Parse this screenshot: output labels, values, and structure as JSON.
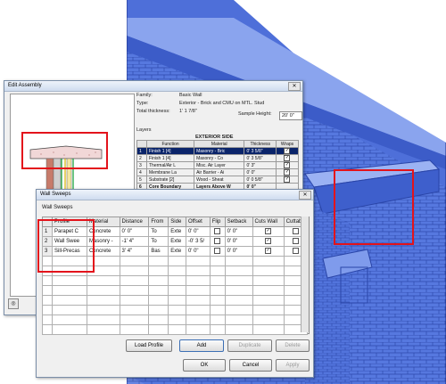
{
  "edit_assembly": {
    "title": "Edit Assembly",
    "family_label": "Family:",
    "family_value": "Basic Wall",
    "type_label": "Type:",
    "type_value": "Exterior - Brick and CMU on MTL. Stud",
    "thickness_label": "Total thickness:",
    "thickness_value": "1' 1 7/8\"",
    "sample_label": "Sample Height:",
    "sample_value": "20' 0\"",
    "layers_label": "Layers",
    "exterior_side": "EXTERIOR SIDE",
    "columns": [
      "Function",
      "Material",
      "Thickness",
      "Wraps"
    ],
    "rows": [
      {
        "n": "1",
        "function": "Finish 1 [4]",
        "material": "Masonry - Bric",
        "thickness": "0' 3 5/8\"",
        "wraps": true,
        "selected": true
      },
      {
        "n": "2",
        "function": "Finish 1 [4]",
        "material": "Masonry - Co",
        "thickness": "0' 3 5/8\"",
        "wraps": true
      },
      {
        "n": "3",
        "function": "Thermal/Air L",
        "material": "Misc. Air Layer",
        "thickness": "0' 3\"",
        "wraps": true
      },
      {
        "n": "4",
        "function": "Membrane La",
        "material": "Air Barrier - Ai",
        "thickness": "0' 0\"",
        "wraps": true
      },
      {
        "n": "5",
        "function": "Substrate [2]",
        "material": "Wood - Sheat",
        "thickness": "0' 0 5/8\"",
        "wraps": true
      },
      {
        "n": "6",
        "function": "Core Boundary",
        "material": "Layers Above W",
        "thickness": "0' 0\"",
        "wraps": null,
        "core": true
      }
    ]
  },
  "wall_sweeps": {
    "title": "Wall Sweeps",
    "section_label": "Wall Sweeps",
    "columns": [
      "Profile",
      "Material",
      "Distance",
      "From",
      "Side",
      "Offset",
      "Flip",
      "Setback",
      "Cuts Wall",
      "Cuttab"
    ],
    "rows": [
      {
        "n": "1",
        "profile": "Parapet C",
        "material": "Concrete",
        "distance": "0' 0\"",
        "from": "To",
        "side": "Exte",
        "offset": "0' 0\"",
        "flip": false,
        "setback": "0' 0\"",
        "cuts_wall": true,
        "cuttable": false
      },
      {
        "n": "2",
        "profile": "Wall Swee",
        "material": "Masonry -",
        "distance": "-1' 4\"",
        "from": "To",
        "side": "Exte",
        "offset": "-0' 3 5/",
        "flip": false,
        "setback": "0' 0\"",
        "cuts_wall": true,
        "cuttable": false
      },
      {
        "n": "3",
        "profile": "Sill-Precas",
        "material": "Concrete",
        "distance": "3' 4\"",
        "from": "Bas",
        "side": "Exte",
        "offset": "0' 0\"",
        "flip": false,
        "setback": "0' 0\"",
        "cuts_wall": true,
        "cuttable": false
      }
    ],
    "buttons": {
      "load_profile": "Load Profile",
      "add": "Add",
      "duplicate": "Duplicate",
      "delete": "Delete",
      "ok": "OK",
      "cancel": "Cancel",
      "apply": "Apply"
    }
  },
  "colors": {
    "wall_blue": "#4a6fd6",
    "highlight_red": "#e3131b",
    "selection_blue": "#0a246a"
  },
  "icons": {
    "preview_toggle": "view-icon",
    "close": "close-icon"
  }
}
